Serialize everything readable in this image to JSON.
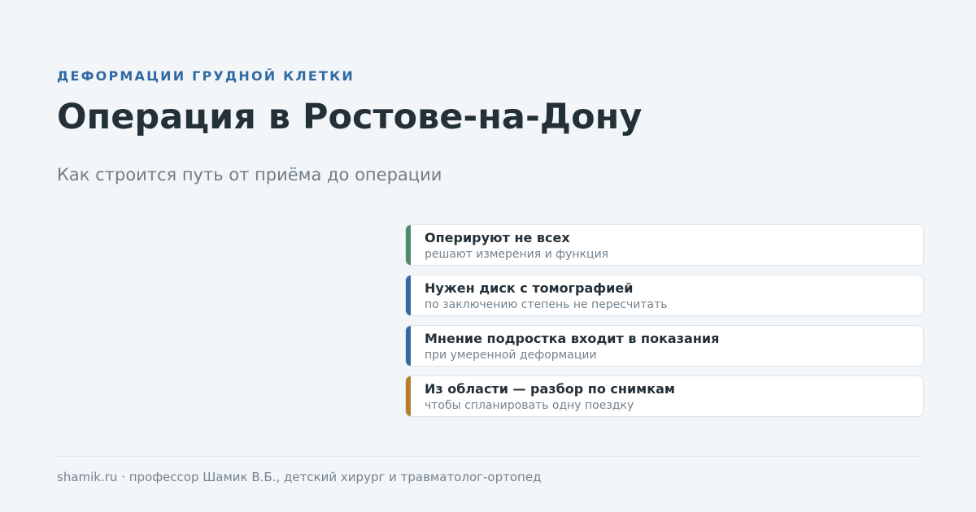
{
  "header": {
    "eyebrow": "ДЕФОРМАЦИИ ГРУДНОЙ КЛЕТКИ",
    "title": "Операция в Ростове-на-Дону",
    "subtitle": "Как строится путь от приёма до операции"
  },
  "cards": [
    {
      "title": "Оперируют не всех",
      "subtitle": "решают измерения и функция",
      "accent_color": "#4f8a6b"
    },
    {
      "title": "Нужен диск с томографией",
      "subtitle": "по заключению степень не пересчитать",
      "accent_color": "#2f6aa3"
    },
    {
      "title": "Мнение подростка входит в показания",
      "subtitle": "при умеренной деформации",
      "accent_color": "#2f6aa3"
    },
    {
      "title": "Из области — разбор по снимкам",
      "subtitle": "чтобы спланировать одну поездку",
      "accent_color": "#b87d2c"
    }
  ],
  "footer": {
    "text": "shamik.ru · профессор Шамик В.Б., детский хирург и травматолог-ортопед"
  },
  "colors": {
    "background": "#f3f6f9",
    "eyebrow": "#2f6aa3",
    "title": "#243038",
    "muted": "#6f7e89"
  }
}
